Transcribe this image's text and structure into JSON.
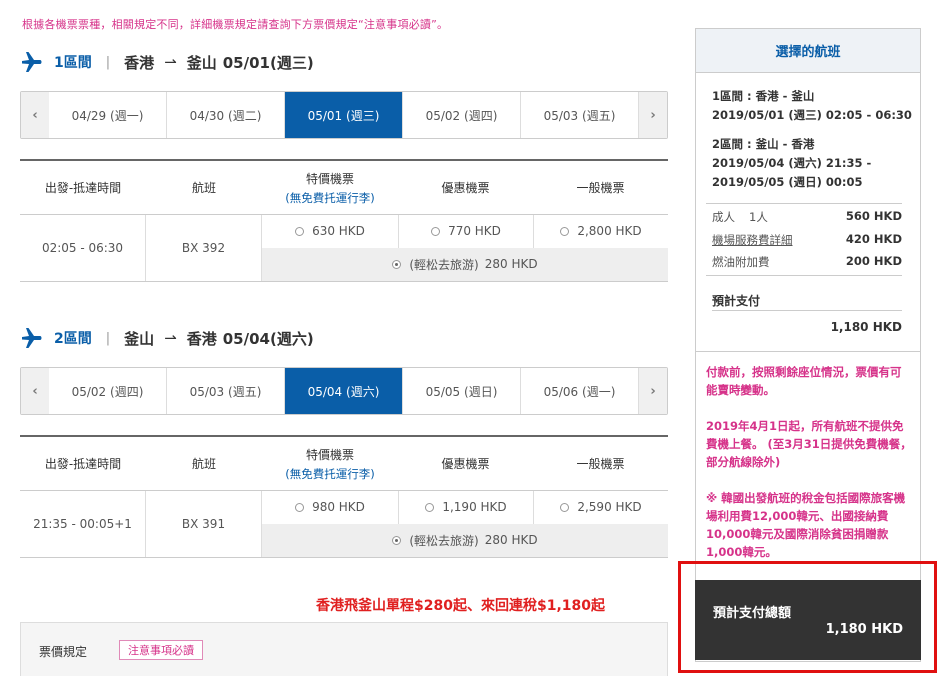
{
  "notice": "根據各機票票種，相關規定不同，詳細機票規定請查詢下方票價規定“注意事項必讀”。",
  "segments": [
    {
      "num": "1區間",
      "from": "香港",
      "to": "釜山",
      "date": "05/01(週三)",
      "tabs": [
        "04/29 (週一)",
        "04/30 (週二)",
        "05/01 (週三)",
        "05/02 (週四)",
        "05/03 (週五)"
      ],
      "active_tab": 2,
      "time": "02:05 - 06:30",
      "flight": "BX 392",
      "prices": [
        "630 HKD",
        "770 HKD",
        "2,800 HKD"
      ],
      "special_label": "(輕松去旅游)",
      "special_price": "280 HKD"
    },
    {
      "num": "2區間",
      "from": "釜山",
      "to": "香港",
      "date": "05/04(週六)",
      "tabs": [
        "05/02 (週四)",
        "05/03 (週五)",
        "05/04 (週六)",
        "05/05 (週日)",
        "05/06 (週一)"
      ],
      "active_tab": 2,
      "time": "21:35 - 00:05+1",
      "flight": "BX 391",
      "prices": [
        "980 HKD",
        "1,190 HKD",
        "2,590 HKD"
      ],
      "special_label": "(輕松去旅游)",
      "special_price": "280 HKD"
    }
  ],
  "table_headers": {
    "time": "出發-抵達時間",
    "flight": "航班",
    "special": "特價機票",
    "special_sub": "(無免費托運行李)",
    "discount": "優惠機票",
    "normal": "一般機票"
  },
  "nav": {
    "prev": "‹",
    "next": "›"
  },
  "sep": "|",
  "promo": "香港飛釜山單程$280起、來回連稅$1,180起",
  "rules": {
    "label": "票價規定",
    "button": "注意事項必讀"
  },
  "panel": {
    "title": "選擇的航班",
    "seg1_line1": "1區間 : 香港 - 釜山",
    "seg1_line2": "2019/05/01 (週三) 02:05 - 06:30",
    "seg2_line1": "2區間 : 釜山 - 香港",
    "seg2_line2": "2019/05/04 (週六) 21:35 -",
    "seg2_line3": "2019/05/05 (週日) 00:05",
    "adult_label": "成人",
    "adult_count": "1人",
    "adult_value": "560 HKD",
    "service_label": "機場服務費詳細",
    "service_value": "420 HKD",
    "fuel_label": "燃油附加費",
    "fuel_value": "200 HKD",
    "pay_label": "預計支付",
    "pay_value": "1,180 HKD",
    "note1": "付款前，按照剩餘座位情況，票價有可能賣時變動。",
    "note2": "2019年4月1日起，所有航班不提供免費機上餐。 (至3月31日提供免費機餐，部分航線除外)",
    "note3": "※ 韓國出發航班的稅金包括國際旅客機場利用費12,000韓元、出國接納費10,000韓元及國際消除貧困捐贈款1,000韓元。"
  },
  "total": {
    "label": "預計支付總額",
    "value": "1,180 HKD"
  },
  "colors": {
    "brand_blue": "#0a5ea8",
    "pink": "#d6338a",
    "promo_red": "#e02020",
    "highlight": "#e01010"
  }
}
